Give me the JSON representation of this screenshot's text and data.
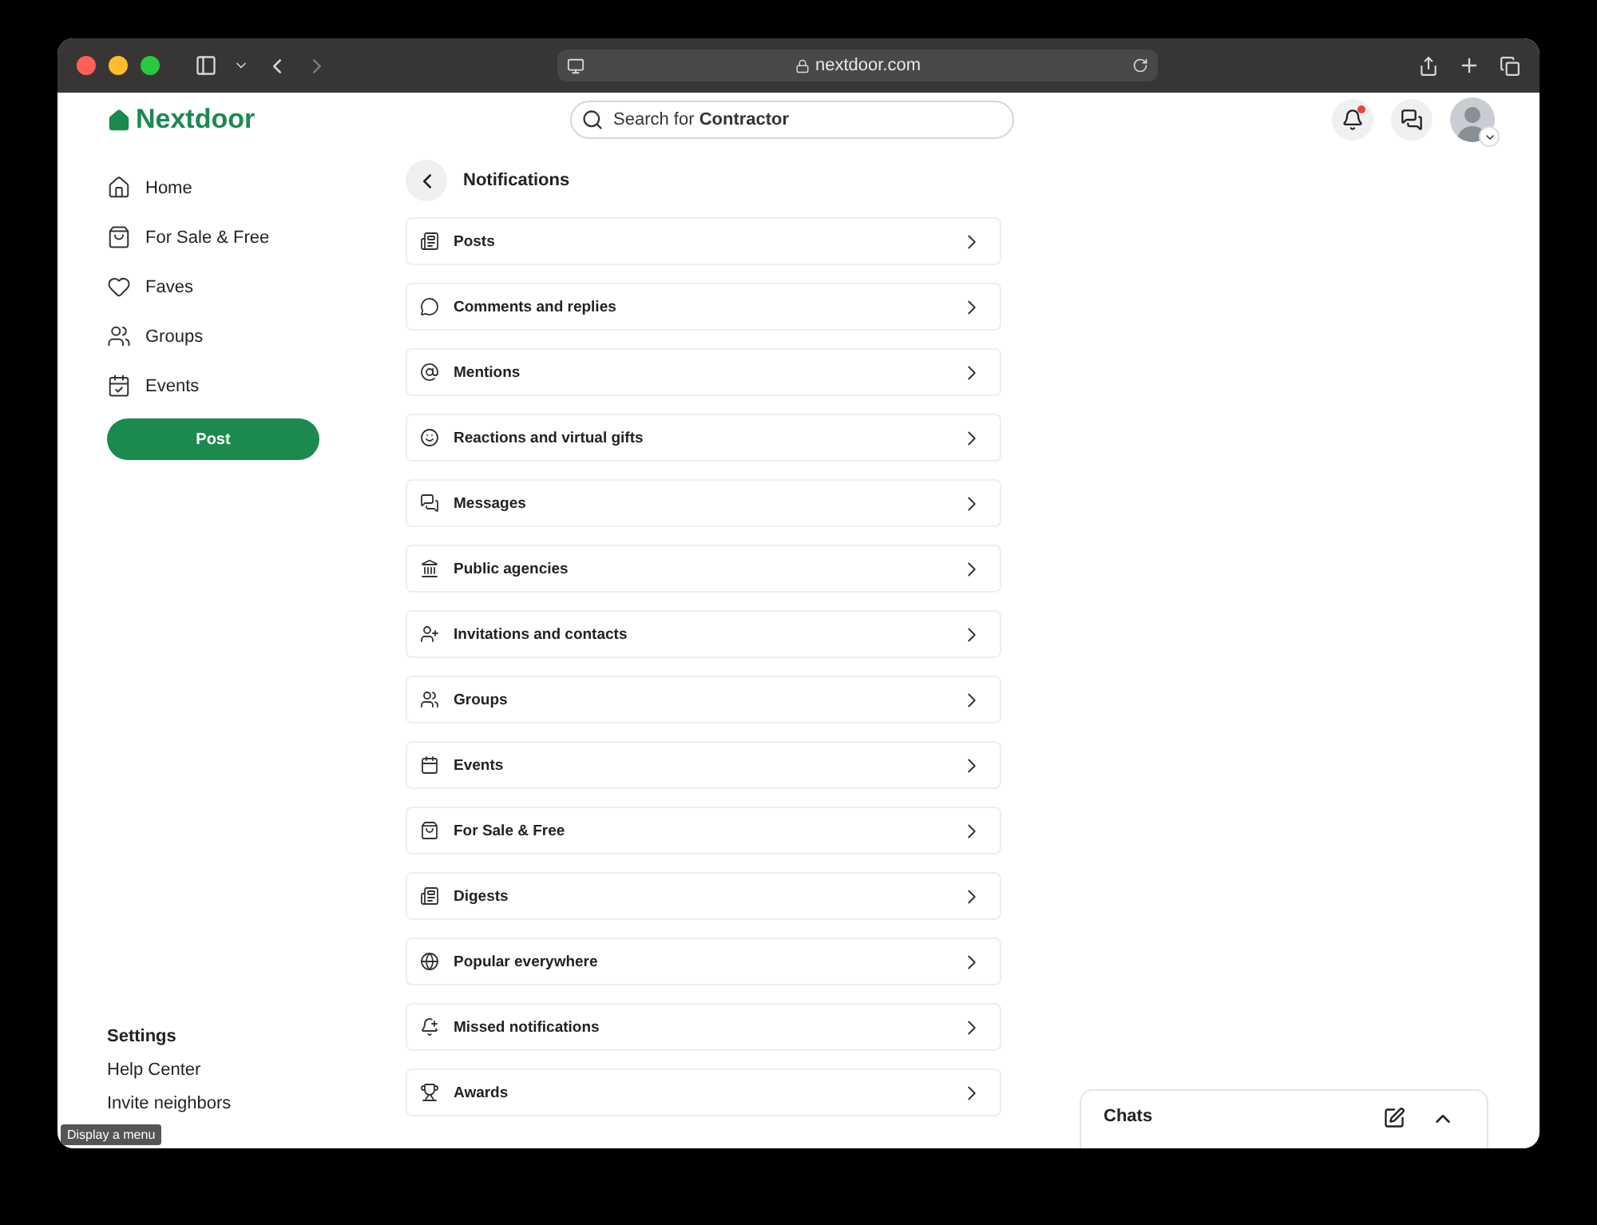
{
  "browser": {
    "url": "nextdoor.com",
    "forward_disabled": true
  },
  "header": {
    "logo": "Nextdoor",
    "search": "Search for **Contractor**",
    "has_unread": true
  },
  "sidebar": {
    "items": [
      {
        "label": "Home"
      },
      {
        "label": "For Sale & Free"
      },
      {
        "label": "Faves"
      },
      {
        "label": "Groups"
      },
      {
        "label": "Events"
      }
    ],
    "post_button": "Post",
    "footer": [
      {
        "label": "Settings",
        "kind": "heading"
      },
      {
        "label": "Help Center",
        "kind": "link"
      },
      {
        "label": "Invite neighbors",
        "kind": "link"
      }
    ]
  },
  "page": {
    "title": "Notifications",
    "rows": [
      {
        "label": "Posts"
      },
      {
        "label": "Comments and replies"
      },
      {
        "label": "Mentions"
      },
      {
        "label": "Reactions and virtual gifts"
      },
      {
        "label": "Messages"
      },
      {
        "label": "Public agencies"
      },
      {
        "label": "Invitations and contacts"
      },
      {
        "label": "Groups"
      },
      {
        "label": "Events"
      },
      {
        "label": "For Sale & Free"
      },
      {
        "label": "Digests"
      },
      {
        "label": "Popular everywhere"
      },
      {
        "label": "Missed notifications"
      },
      {
        "label": "Awards"
      }
    ]
  },
  "chats": {
    "title": "Chats"
  },
  "tooltip": "Display a menu"
}
